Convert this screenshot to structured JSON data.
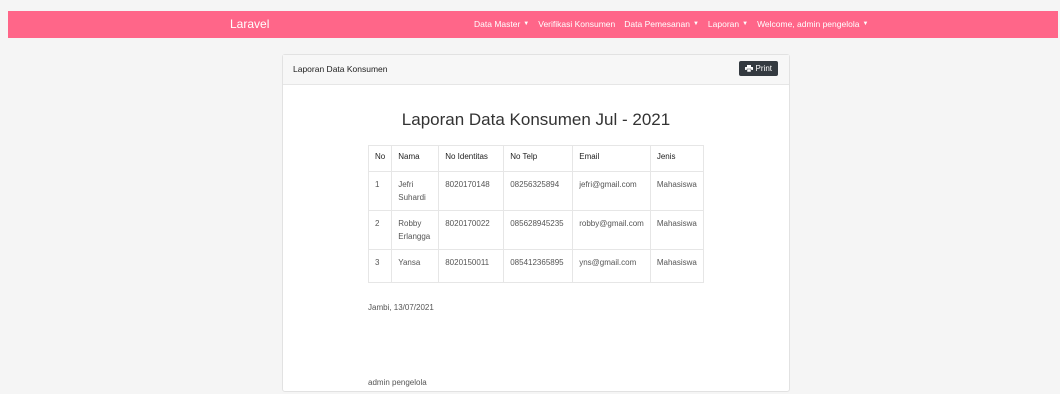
{
  "navbar": {
    "brand": "Laravel",
    "items": [
      {
        "label": "Data Master",
        "dropdown": true
      },
      {
        "label": "Verifikasi Konsumen",
        "dropdown": false
      },
      {
        "label": "Data Pemesanan",
        "dropdown": true
      },
      {
        "label": "Laporan",
        "dropdown": true
      },
      {
        "label": "Welcome, admin pengelola",
        "dropdown": true
      }
    ],
    "caret": "▼"
  },
  "card": {
    "header_title": "Laporan Data Konsumen",
    "print_label": "Print"
  },
  "report": {
    "title": "Laporan Data Konsumen Jul - 2021",
    "columns": [
      "No",
      "Nama",
      "No Identitas",
      "No Telp",
      "Email",
      "Jenis"
    ],
    "rows": [
      {
        "no": "1",
        "nama": "Jefri Suhardi",
        "identitas": "8020170148",
        "telp": "08256325894",
        "email": "jefri@gmail.com",
        "jenis": "Mahasiswa"
      },
      {
        "no": "2",
        "nama": "Robby Erlangga",
        "identitas": "8020170022",
        "telp": "085628945235",
        "email": "robby@gmail.com",
        "jenis": "Mahasiswa"
      },
      {
        "no": "3",
        "nama": "Yansa",
        "identitas": "8020150011",
        "telp": "085412365895",
        "email": "yns@gmail.com",
        "jenis": "Mahasiswa"
      }
    ],
    "place_date": "Jambi, 13/07/2021",
    "signer": "admin pengelola"
  },
  "colors": {
    "navbar": "#ff6689",
    "print_button": "#343a40"
  }
}
